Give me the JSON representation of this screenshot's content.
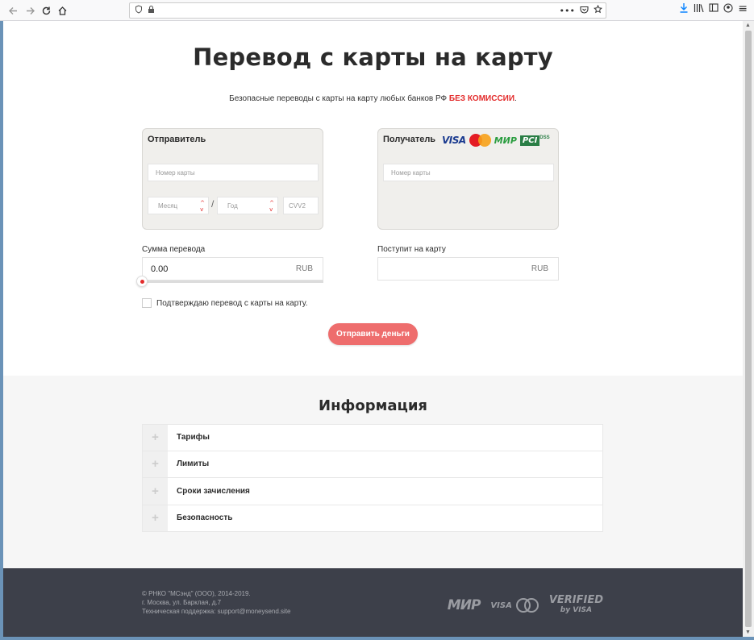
{
  "browser": {
    "back_icon": "arrow-left-icon",
    "forward_icon": "arrow-right-icon",
    "reload_icon": "reload-icon",
    "home_icon": "home-icon",
    "more_icon": "•••",
    "menu_icon": "≡"
  },
  "page": {
    "title": "Перевод с карты на карту",
    "subtitle": "Безопасные переводы с карты на карту любых банков РФ",
    "subtitle_highlight": "БЕЗ КОМИССИИ",
    "subtitle_end": "."
  },
  "sender": {
    "title": "Отправитель",
    "card_placeholder": "Номер карты",
    "month_placeholder": "Месяц",
    "year_placeholder": "Год",
    "cvv_placeholder": "CVV2",
    "slash": "/"
  },
  "receiver": {
    "title": "Получатель",
    "card_placeholder": "Номер карты",
    "logos": {
      "visa": "VISA",
      "mastercard": "MasterCard",
      "mir": "МИР",
      "pci": "PCI",
      "dss": "DSS"
    }
  },
  "amount": {
    "label": "Сумма перевода",
    "value": "0.00",
    "currency": "RUB",
    "slider_level": 0
  },
  "receive": {
    "label": "Поступит на карту",
    "value": "",
    "currency": "RUB"
  },
  "confirm": {
    "label": "Подтверждаю перевод с карты на карту.",
    "checked": false
  },
  "submit_label": "Отправить деньги",
  "info": {
    "title": "Информация",
    "items": [
      {
        "label": "Тарифы"
      },
      {
        "label": "Лимиты"
      },
      {
        "label": "Сроки зачисления"
      },
      {
        "label": "Безопасность"
      }
    ],
    "expand_icon": "+"
  },
  "footer": {
    "line1": "© РНКО \"МСэнд\" (ООО), 2014-2019.",
    "line2": "г. Москва, ул. Барклая, д.7",
    "line3": "Техническая поддержка: support@moneysend.site",
    "logos": {
      "mir": "МИР",
      "visa": "VISA",
      "verified": "VERIFIED",
      "by_visa": "by VISA"
    }
  },
  "colors": {
    "accent": "#e32c2c",
    "button": "#ee6d6d",
    "footer": "#3d404a"
  }
}
